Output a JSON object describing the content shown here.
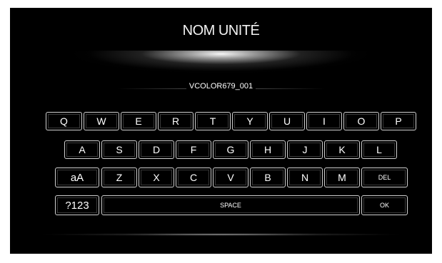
{
  "header": {
    "title": "NOM UNITÉ"
  },
  "name_field": {
    "value": "VCOLOR679_001"
  },
  "keyboard": {
    "row1": [
      "Q",
      "W",
      "E",
      "R",
      "T",
      "Y",
      "U",
      "I",
      "O",
      "P"
    ],
    "row2": [
      "A",
      "S",
      "D",
      "F",
      "G",
      "H",
      "J",
      "K",
      "L"
    ],
    "row3": {
      "shift": "aA",
      "letters": [
        "Z",
        "X",
        "C",
        "V",
        "B",
        "N",
        "M"
      ],
      "delete": "DEL"
    },
    "row4": {
      "symbols": "?123",
      "space": "SPACE",
      "ok": "OK"
    }
  },
  "colors": {
    "background": "#000000",
    "key_border": "#cfcfcf",
    "text": "#ffffff"
  }
}
